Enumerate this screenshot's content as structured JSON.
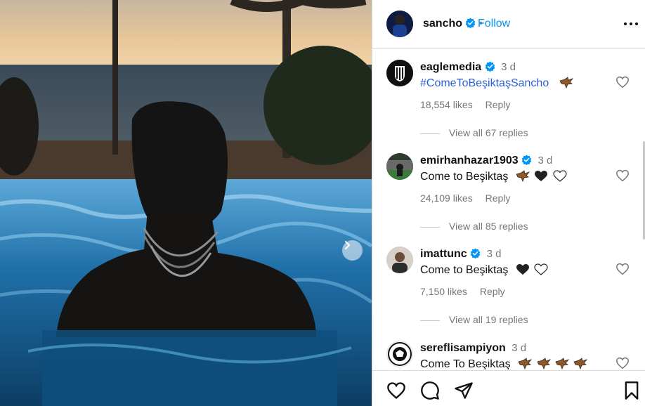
{
  "post": {
    "author": "sancho",
    "follow_label": "Follow",
    "separator": "•"
  },
  "comments": [
    {
      "username": "eaglemedia",
      "verified": true,
      "time": "3 d",
      "text": "#ComeToBeşiktaşSancho",
      "text_is_hashtag": true,
      "emojis": [
        "eagle"
      ],
      "likes": "18,554 likes",
      "reply_label": "Reply",
      "view_replies": "View all 67 replies"
    },
    {
      "username": "emirhanhazar1903",
      "verified": true,
      "time": "3 d",
      "text": "Come to Beşiktaş",
      "emojis": [
        "eagle",
        "black-heart",
        "white-heart"
      ],
      "likes": "24,109 likes",
      "reply_label": "Reply",
      "view_replies": "View all 85 replies"
    },
    {
      "username": "imattunc",
      "verified": true,
      "time": "3 d",
      "text": "Come to Beşiktaş",
      "emojis": [
        "black-heart",
        "white-heart"
      ],
      "likes": "7,150 likes",
      "reply_label": "Reply",
      "view_replies": "View all 19 replies"
    },
    {
      "username": "sereflisampiyon",
      "verified": false,
      "time": "3 d",
      "text": "Come To Beşiktaş",
      "emojis": [
        "eagle",
        "eagle",
        "eagle",
        "eagle"
      ],
      "likes": "",
      "reply_label": "",
      "view_replies": ""
    }
  ],
  "icons": {
    "like": "heart-icon",
    "comment": "comment-icon",
    "share": "share-icon",
    "save": "bookmark-icon",
    "more": "more-icon",
    "next": "chevron-right-icon",
    "verified": "verified-badge-icon"
  },
  "colors": {
    "link": "#0095f6",
    "hashtag": "#2b5fd9",
    "verified": "#0095f6",
    "muted": "#777777"
  }
}
